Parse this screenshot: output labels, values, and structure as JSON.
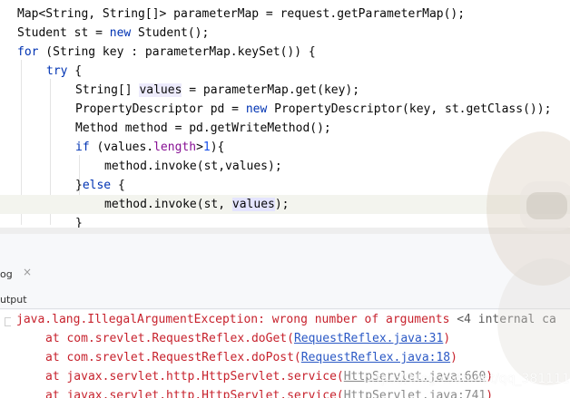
{
  "editor": {
    "lines": [
      {
        "parts": [
          "Map<String, String[]> parameterMap = request.getParameterMap();"
        ]
      },
      {
        "parts": [
          "Student st = ",
          "new",
          " Student();"
        ]
      },
      {
        "parts": [
          "for",
          " (String key : parameterMap.keySet()) {"
        ]
      },
      {
        "parts": [
          "try",
          " {"
        ]
      },
      {
        "parts": [
          "String[] ",
          "values",
          " = parameterMap.get(key);"
        ]
      },
      {
        "parts": [
          "PropertyDescriptor pd = ",
          "new",
          " PropertyDescriptor(key, st.getClass());"
        ]
      },
      {
        "parts": [
          "Method method = pd.getWriteMethod();"
        ]
      },
      {
        "parts": [
          "if",
          " (values.",
          "length",
          ">",
          "1",
          "){"
        ]
      },
      {
        "parts": [
          "method.invoke(st,values);"
        ]
      },
      {
        "parts": [
          "}",
          "else",
          " {"
        ]
      },
      {
        "parts": [
          "method.invoke(st, ",
          "values",
          ");"
        ]
      },
      {
        "parts": [
          "}"
        ]
      }
    ]
  },
  "panel": {
    "tab_label": "og",
    "tab_close": "×",
    "subtab_label": "utput"
  },
  "console": {
    "exception": "java.lang.IllegalArgumentException: wrong number of arguments",
    "internal": " <4 internal ca",
    "frames": [
      {
        "prefix": "at com.srevlet.RequestReflex.doGet(",
        "link": "RequestReflex.java:31",
        "suffix": ")"
      },
      {
        "prefix": "at com.srevlet.RequestReflex.doPost(",
        "link": "RequestReflex.java:18",
        "suffix": ")"
      },
      {
        "prefix": "at javax.servlet.http.HttpServlet.service(",
        "link": "HttpServlet.java:660",
        "suffix": ")"
      },
      {
        "prefix": "at javax.servlet.http.HttpServlet.service(",
        "link": "HttpServlet.java:741",
        "suffix": ")"
      }
    ]
  },
  "watermark": "https://blog.csdn.net/qq_381111",
  "colors": {
    "keyword": "#0033b3",
    "error": "#c7222d",
    "link": "#2a58c5",
    "current_line": "#f3f4ee"
  }
}
